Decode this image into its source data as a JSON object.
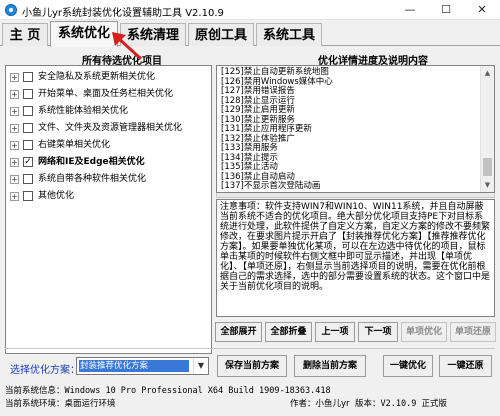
{
  "window": {
    "title": "小鱼儿yr系统封装优化设置辅助工具 V2.10.9",
    "minimize": "—",
    "maximize": "☐",
    "close": "✕"
  },
  "tabs": [
    {
      "label": "主 页"
    },
    {
      "label": "系统优化"
    },
    {
      "label": "系统清理"
    },
    {
      "label": "原创工具"
    },
    {
      "label": "系统工具"
    }
  ],
  "left_panel": {
    "header": "所有待选优化项目",
    "items": [
      {
        "label": "安全隐私及系统更新相关优化",
        "expander": "+",
        "checked": false
      },
      {
        "label": "开始菜单、桌面及任务栏相关优化",
        "expander": "+",
        "checked": false
      },
      {
        "label": "系统性能体验相关优化",
        "expander": "+",
        "checked": false
      },
      {
        "label": "文件、文件夹及资源管理器相关优化",
        "expander": "+",
        "checked": false
      },
      {
        "label": "右键菜单相关优化",
        "expander": "+",
        "checked": false
      },
      {
        "label": "网络和IE及Edge相关优化",
        "expander": "+",
        "checked": true
      },
      {
        "label": "系统自带各种软件相关优化",
        "expander": "+",
        "checked": false
      },
      {
        "label": "其他优化",
        "expander": "+",
        "checked": false
      }
    ]
  },
  "right_panel": {
    "header": "优化详情进度及说明内容",
    "details": [
      "[125]禁止自动更新系统地图",
      "[126]禁用Windows媒体中心",
      "[127]禁用错误报告",
      "[128]禁止显示运行",
      "[129]禁止启用更新",
      "[130]禁止更新服务",
      "[131]禁止应用程序更新",
      "[132]禁止体验推广",
      "[133]禁用服务",
      "[134]禁止提示",
      "[135]禁止活动",
      "[136]禁止自动启动",
      "[137]不显示首次登陆动画"
    ],
    "notes": "注意事项：软件支持WIN7和WIN10、WIN11系统，并且自动屏蔽当前系统不适合的优化项目。绝大部分优化项目支持PE下对目标系统进行处理，此软件提供了自定义方案，自定义方案的修改不要频繁修改，在要求图片提示开启了【封装推荐优化方案】【推荐推荐优化方案】。如果要单独优化某项，可以在左边选中待优化的项目，鼠标单击某项的时候软件右侧文框中即可显示描述，并出现【单项优化】、【单项还原】，右侧显示当前选择项目的说明，需要在优化前根据自己的需求选择，选中的部分需要设置系统的状态。这个窗口中是关于当前优化项目的说明。"
  },
  "action_buttons": {
    "expand_all": "全部展开",
    "collapse_all": "全部折叠",
    "prev": "上一项",
    "next": "下一项",
    "item_optimize": "单项优化",
    "item_restore": "单项还原"
  },
  "scheme": {
    "label": "选择优化方案：",
    "selected": "封装推荐优化方案",
    "save": "保存当前方案",
    "delete": "删除当前方案",
    "one_click_optimize": "一键优化",
    "one_click_restore": "一键还原"
  },
  "status": {
    "system_info_label": "当前系统信息：",
    "system_info": "Windows 10 Pro Professional X64 Build 1909-18363.418",
    "env_label": "当前系统环境：",
    "env": "桌面运行环境",
    "author_label": "作者：",
    "author": "小鱼儿yr",
    "version_label": "版本：",
    "version": "V2.10.9 正式版"
  },
  "colors": {
    "selection_blue": "#3a78d8",
    "label_blue": "#1a3cb8",
    "cursor_red": "#d42020"
  },
  "icons": {
    "cursor": "red-arrow-pointer",
    "app": "fish-app-icon"
  }
}
